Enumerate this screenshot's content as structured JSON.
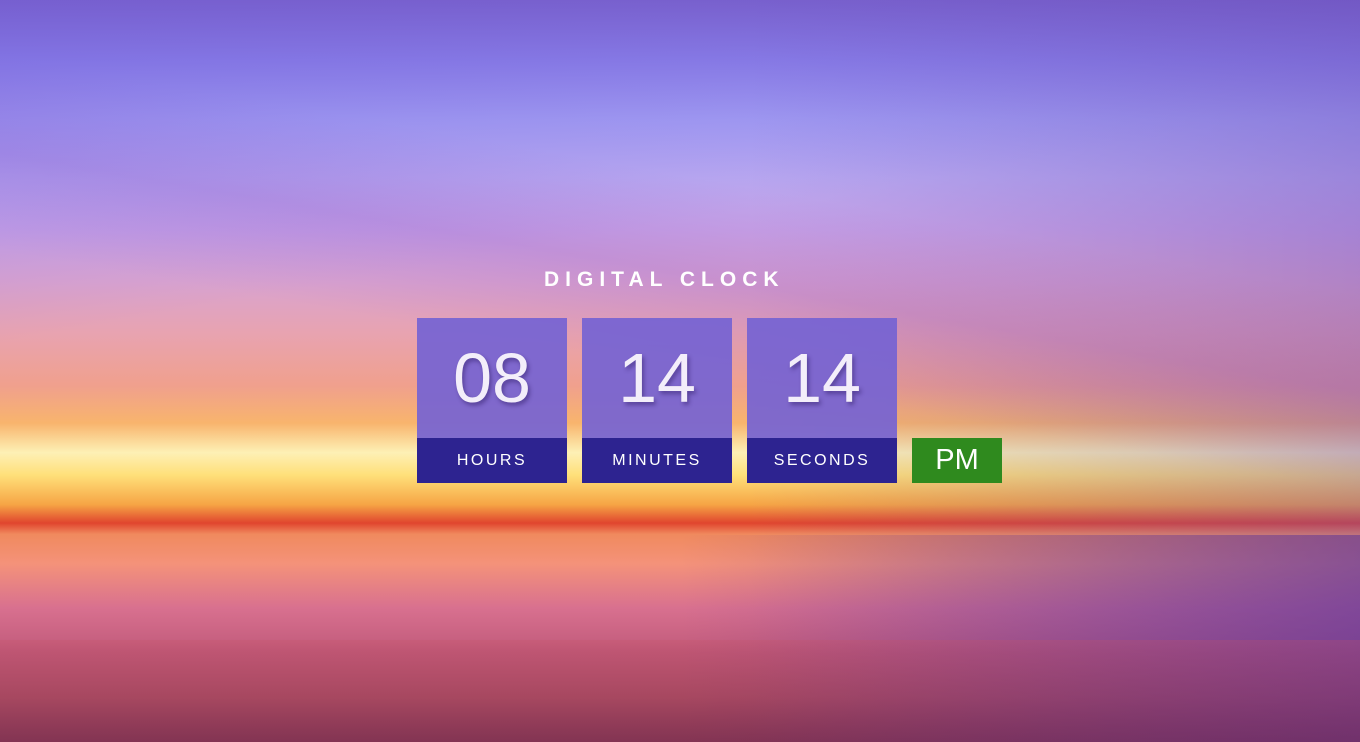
{
  "title": "DIGITAL CLOCK",
  "time": {
    "hours": "08",
    "minutes": "14",
    "seconds": "14",
    "period": "PM"
  },
  "labels": {
    "hours": "HOURS",
    "minutes": "MINUTES",
    "seconds": "SECONDS"
  },
  "colors": {
    "digit_box": "#7563d2",
    "label_bar": "#2d2390",
    "period_badge": "#2f8a1e",
    "text": "#ffffff"
  }
}
